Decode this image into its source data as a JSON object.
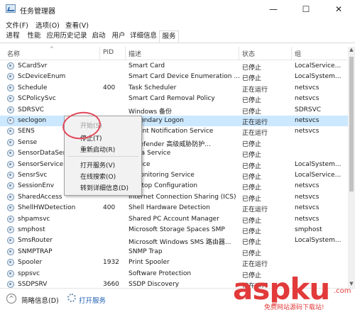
{
  "window": {
    "title": "任务管理器",
    "controls": {
      "minimize": "—",
      "maximize": "☐",
      "close": "✕"
    }
  },
  "menubar": {
    "items": [
      "文件(F)",
      "选项(O)",
      "查看(V)"
    ]
  },
  "tabs": {
    "items": [
      "进程",
      "性能",
      "应用历史记录",
      "启动",
      "用户",
      "详细信息",
      "服务"
    ],
    "active": "服务"
  },
  "table": {
    "columns": {
      "name": "名称",
      "pid": "PID",
      "description": "描述",
      "status": "状态",
      "group": "组"
    },
    "sort_arrow": "^",
    "rows": [
      {
        "name": "SCardSvr",
        "pid": "",
        "description": "Smart Card",
        "status": "已停止",
        "group": "LocalService..."
      },
      {
        "name": "ScDeviceEnum",
        "pid": "",
        "description": "Smart Card Device Enumeration ...",
        "status": "已停止",
        "group": "LocalSystem..."
      },
      {
        "name": "Schedule",
        "pid": "400",
        "description": "Task Scheduler",
        "status": "正在运行",
        "group": "netsvcs"
      },
      {
        "name": "SCPolicySvc",
        "pid": "",
        "description": "Smart Card Removal Policy",
        "status": "已停止",
        "group": "netsvcs"
      },
      {
        "name": "SDRSVC",
        "pid": "",
        "description": "Windows 备份",
        "status": "已停止",
        "group": "SDRSVC"
      },
      {
        "name": "seclogon",
        "pid": "",
        "description": "Secondary Logon",
        "status": "正在运行",
        "group": "netsvcs"
      },
      {
        "name": "SENS",
        "pid": "",
        "description": "...vent Notification Service",
        "status": "正在运行",
        "group": "netsvcs"
      },
      {
        "name": "Sense",
        "pid": "",
        "description": "...Defender 高级威胁防护...",
        "status": "已停止",
        "group": ""
      },
      {
        "name": "SensorDataSer...",
        "pid": "",
        "description": "...ata Service",
        "status": "已停止",
        "group": ""
      },
      {
        "name": "SensorService",
        "pid": "",
        "description": "...rvice",
        "status": "已停止",
        "group": "LocalSystem..."
      },
      {
        "name": "SensrSvc",
        "pid": "",
        "description": "...Monitoring Service",
        "status": "已停止",
        "group": "LocalService..."
      },
      {
        "name": "SessionEnv",
        "pid": "",
        "description": "...sktop Configuration",
        "status": "已停止",
        "group": "netsvcs"
      },
      {
        "name": "SharedAccess",
        "pid": "",
        "description": "Internet Connection Sharing (ICS)",
        "status": "已停止",
        "group": "netsvcs"
      },
      {
        "name": "ShellHWDetection",
        "pid": "400",
        "description": "Shell Hardware Detection",
        "status": "正在运行",
        "group": "netsvcs"
      },
      {
        "name": "shpamsvc",
        "pid": "",
        "description": "Shared PC Account Manager",
        "status": "已停止",
        "group": "netsvcs"
      },
      {
        "name": "smphost",
        "pid": "",
        "description": "Microsoft Storage Spaces SMP",
        "status": "已停止",
        "group": "smphost"
      },
      {
        "name": "SmsRouter",
        "pid": "",
        "description": "Microsoft Windows SMS 路由器...",
        "status": "已停止",
        "group": "LocalSystem..."
      },
      {
        "name": "SNMPTRAP",
        "pid": "",
        "description": "SNMP Trap",
        "status": "已停止",
        "group": ""
      },
      {
        "name": "Spooler",
        "pid": "1932",
        "description": "Print Spooler",
        "status": "正在运行",
        "group": ""
      },
      {
        "name": "sppsvc",
        "pid": "",
        "description": "Software Protection",
        "status": "已停止",
        "group": ""
      },
      {
        "name": "SSDPSRV",
        "pid": "3660",
        "description": "SSDP Discovery",
        "status": "正在运行",
        "group": ""
      }
    ]
  },
  "context_menu": {
    "items": [
      {
        "label": "开始(S)",
        "enabled": false
      },
      {
        "label": "停止(T)",
        "enabled": true
      },
      {
        "label": "重新启动(R)",
        "enabled": true
      },
      {
        "label": "打开服务(V)",
        "enabled": true
      },
      {
        "label": "在线搜索(O)",
        "enabled": true
      },
      {
        "label": "转到详细信息(D)",
        "enabled": true
      }
    ]
  },
  "footer": {
    "chevron": "^",
    "less_details": "简略信息(D)",
    "open_services": "打开服务"
  },
  "watermark": {
    "brand": "aspku",
    "tld": ".com",
    "slogan": "免费网站源码下载站!"
  },
  "colors": {
    "selection": "#cce8ff",
    "link": "#1f5fb5",
    "annotation": "#e2485a",
    "watermark": "#e23a3a"
  },
  "icons": {
    "service": "service-gear-icon",
    "app": "task-manager-icon",
    "footer_toggle": "chevron-up-icon",
    "open_services": "services-icon"
  }
}
